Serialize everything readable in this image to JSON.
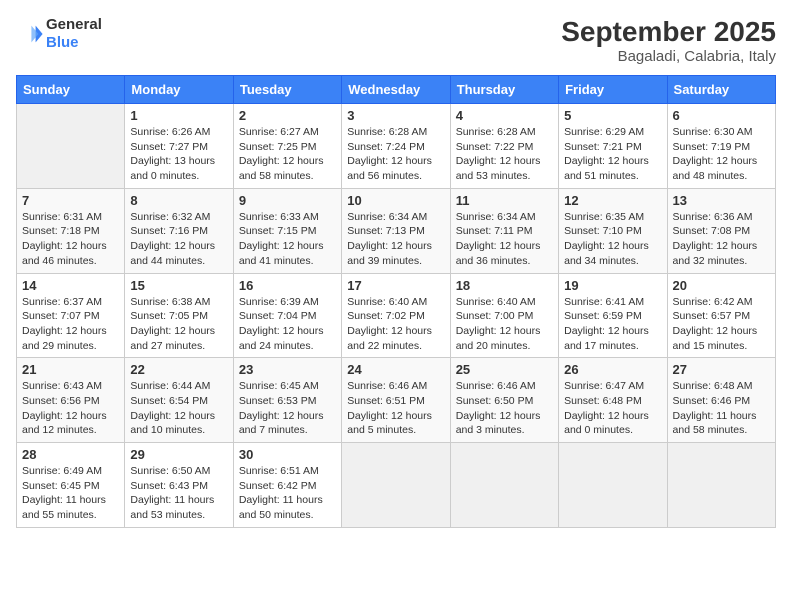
{
  "header": {
    "logo_line1": "General",
    "logo_line2": "Blue",
    "title": "September 2025",
    "subtitle": "Bagaladi, Calabria, Italy"
  },
  "days_of_week": [
    "Sunday",
    "Monday",
    "Tuesday",
    "Wednesday",
    "Thursday",
    "Friday",
    "Saturday"
  ],
  "weeks": [
    [
      {
        "day": "",
        "info": ""
      },
      {
        "day": "1",
        "info": "Sunrise: 6:26 AM\nSunset: 7:27 PM\nDaylight: 13 hours\nand 0 minutes."
      },
      {
        "day": "2",
        "info": "Sunrise: 6:27 AM\nSunset: 7:25 PM\nDaylight: 12 hours\nand 58 minutes."
      },
      {
        "day": "3",
        "info": "Sunrise: 6:28 AM\nSunset: 7:24 PM\nDaylight: 12 hours\nand 56 minutes."
      },
      {
        "day": "4",
        "info": "Sunrise: 6:28 AM\nSunset: 7:22 PM\nDaylight: 12 hours\nand 53 minutes."
      },
      {
        "day": "5",
        "info": "Sunrise: 6:29 AM\nSunset: 7:21 PM\nDaylight: 12 hours\nand 51 minutes."
      },
      {
        "day": "6",
        "info": "Sunrise: 6:30 AM\nSunset: 7:19 PM\nDaylight: 12 hours\nand 48 minutes."
      }
    ],
    [
      {
        "day": "7",
        "info": "Sunrise: 6:31 AM\nSunset: 7:18 PM\nDaylight: 12 hours\nand 46 minutes."
      },
      {
        "day": "8",
        "info": "Sunrise: 6:32 AM\nSunset: 7:16 PM\nDaylight: 12 hours\nand 44 minutes."
      },
      {
        "day": "9",
        "info": "Sunrise: 6:33 AM\nSunset: 7:15 PM\nDaylight: 12 hours\nand 41 minutes."
      },
      {
        "day": "10",
        "info": "Sunrise: 6:34 AM\nSunset: 7:13 PM\nDaylight: 12 hours\nand 39 minutes."
      },
      {
        "day": "11",
        "info": "Sunrise: 6:34 AM\nSunset: 7:11 PM\nDaylight: 12 hours\nand 36 minutes."
      },
      {
        "day": "12",
        "info": "Sunrise: 6:35 AM\nSunset: 7:10 PM\nDaylight: 12 hours\nand 34 minutes."
      },
      {
        "day": "13",
        "info": "Sunrise: 6:36 AM\nSunset: 7:08 PM\nDaylight: 12 hours\nand 32 minutes."
      }
    ],
    [
      {
        "day": "14",
        "info": "Sunrise: 6:37 AM\nSunset: 7:07 PM\nDaylight: 12 hours\nand 29 minutes."
      },
      {
        "day": "15",
        "info": "Sunrise: 6:38 AM\nSunset: 7:05 PM\nDaylight: 12 hours\nand 27 minutes."
      },
      {
        "day": "16",
        "info": "Sunrise: 6:39 AM\nSunset: 7:04 PM\nDaylight: 12 hours\nand 24 minutes."
      },
      {
        "day": "17",
        "info": "Sunrise: 6:40 AM\nSunset: 7:02 PM\nDaylight: 12 hours\nand 22 minutes."
      },
      {
        "day": "18",
        "info": "Sunrise: 6:40 AM\nSunset: 7:00 PM\nDaylight: 12 hours\nand 20 minutes."
      },
      {
        "day": "19",
        "info": "Sunrise: 6:41 AM\nSunset: 6:59 PM\nDaylight: 12 hours\nand 17 minutes."
      },
      {
        "day": "20",
        "info": "Sunrise: 6:42 AM\nSunset: 6:57 PM\nDaylight: 12 hours\nand 15 minutes."
      }
    ],
    [
      {
        "day": "21",
        "info": "Sunrise: 6:43 AM\nSunset: 6:56 PM\nDaylight: 12 hours\nand 12 minutes."
      },
      {
        "day": "22",
        "info": "Sunrise: 6:44 AM\nSunset: 6:54 PM\nDaylight: 12 hours\nand 10 minutes."
      },
      {
        "day": "23",
        "info": "Sunrise: 6:45 AM\nSunset: 6:53 PM\nDaylight: 12 hours\nand 7 minutes."
      },
      {
        "day": "24",
        "info": "Sunrise: 6:46 AM\nSunset: 6:51 PM\nDaylight: 12 hours\nand 5 minutes."
      },
      {
        "day": "25",
        "info": "Sunrise: 6:46 AM\nSunset: 6:50 PM\nDaylight: 12 hours\nand 3 minutes."
      },
      {
        "day": "26",
        "info": "Sunrise: 6:47 AM\nSunset: 6:48 PM\nDaylight: 12 hours\nand 0 minutes."
      },
      {
        "day": "27",
        "info": "Sunrise: 6:48 AM\nSunset: 6:46 PM\nDaylight: 11 hours\nand 58 minutes."
      }
    ],
    [
      {
        "day": "28",
        "info": "Sunrise: 6:49 AM\nSunset: 6:45 PM\nDaylight: 11 hours\nand 55 minutes."
      },
      {
        "day": "29",
        "info": "Sunrise: 6:50 AM\nSunset: 6:43 PM\nDaylight: 11 hours\nand 53 minutes."
      },
      {
        "day": "30",
        "info": "Sunrise: 6:51 AM\nSunset: 6:42 PM\nDaylight: 11 hours\nand 50 minutes."
      },
      {
        "day": "",
        "info": ""
      },
      {
        "day": "",
        "info": ""
      },
      {
        "day": "",
        "info": ""
      },
      {
        "day": "",
        "info": ""
      }
    ]
  ]
}
